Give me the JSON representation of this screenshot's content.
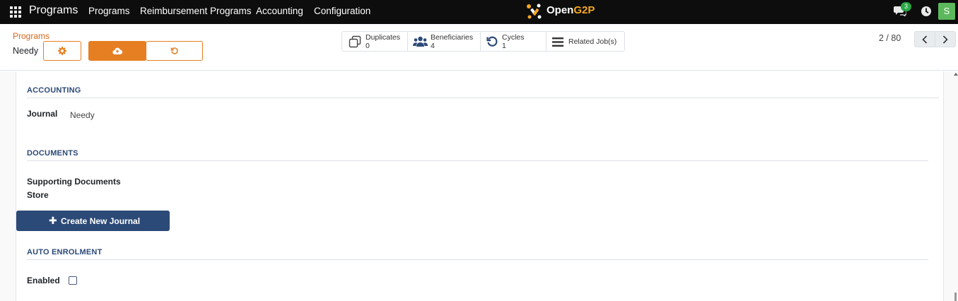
{
  "topbar": {
    "app_title": "Programs",
    "menu": [
      "Programs",
      "Reimbursement Programs",
      "Accounting",
      "Configuration"
    ],
    "logo_text_a": "Open",
    "logo_text_b": "G2P",
    "chat_count": "3",
    "user_initial": "S"
  },
  "breadcrumb": {
    "parent": "Programs",
    "current": "Needy"
  },
  "stats": {
    "duplicates": {
      "label": "Duplicates",
      "value": "0",
      "icon": "copy-icon"
    },
    "beneficiaries": {
      "label": "Beneficiaries",
      "value": "4",
      "icon": "users-icon"
    },
    "cycles": {
      "label": "Cycles",
      "value": "1",
      "icon": "refresh-icon"
    },
    "jobs": {
      "label": "Related Job(s)",
      "icon": "list-icon"
    }
  },
  "pager": {
    "text": "2 / 80"
  },
  "accounting": {
    "title": "ACCOUNTING",
    "journal_label": "Journal",
    "journal_value": "Needy"
  },
  "documents": {
    "title": "DOCUMENTS",
    "store_label_line1": "Supporting Documents",
    "store_label_line2": "Store"
  },
  "create_journal": {
    "label": "Create New Journal"
  },
  "auto_enrolment": {
    "title": "AUTO ENROLMENT",
    "enabled_label": "Enabled",
    "enabled": false
  },
  "colors": {
    "accent_orange": "#e67e22",
    "section_blue": "#2c4a77",
    "chat_badge_green": "#28a745"
  }
}
